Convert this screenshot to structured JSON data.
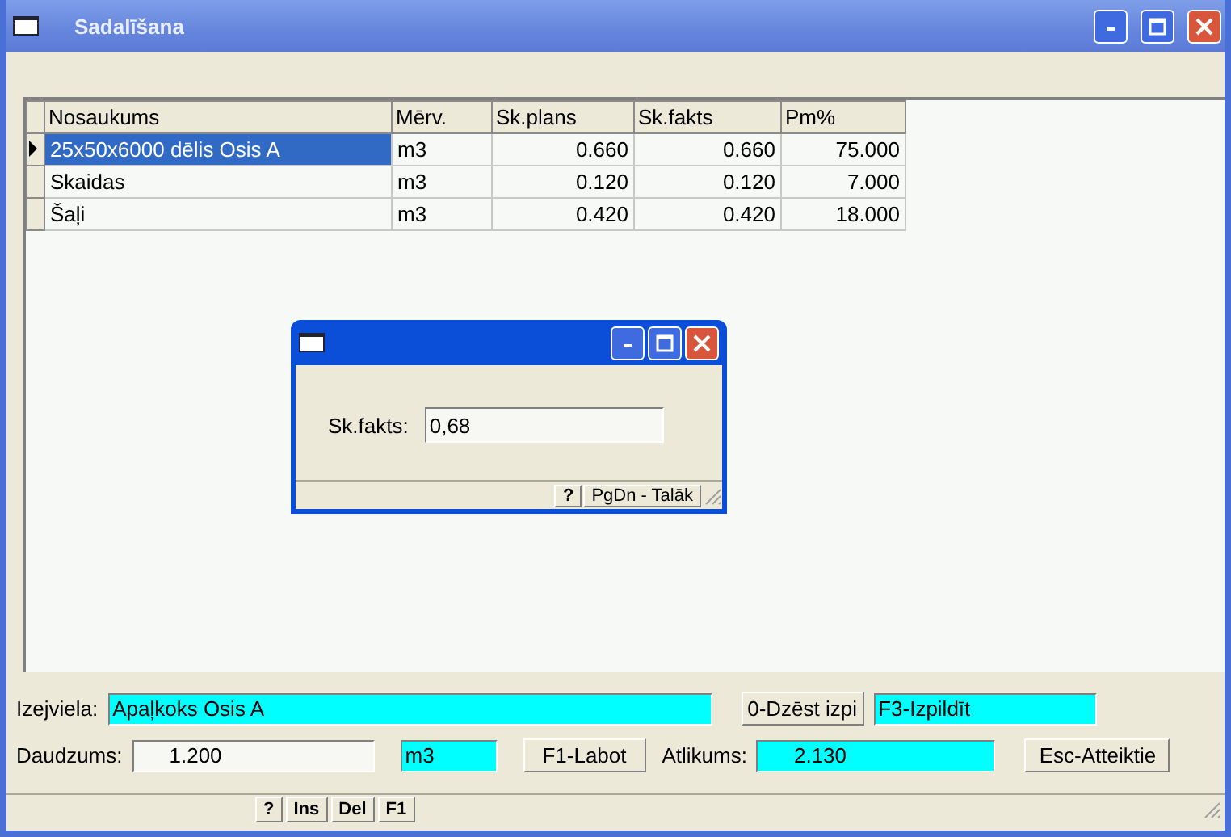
{
  "window": {
    "title": "Sadalīšana"
  },
  "table": {
    "columns": [
      "Nosaukums",
      "Mērv.",
      "Sk.plans",
      "Sk.fakts",
      "Pm%"
    ],
    "rows": [
      {
        "selected": true,
        "cells": [
          "25x50x6000 dēlis Osis A",
          "m3",
          "0.660",
          "0.660",
          "75.000"
        ]
      },
      {
        "selected": false,
        "cells": [
          "Skaidas",
          "m3",
          "0.120",
          "0.120",
          "7.000"
        ]
      },
      {
        "selected": false,
        "cells": [
          "Šaļi",
          "m3",
          "0.420",
          "0.420",
          "18.000"
        ]
      }
    ]
  },
  "dialog": {
    "label": "Sk.fakts:",
    "value": "0,68",
    "status_keys": [
      "?",
      "PgDn - Talāk"
    ]
  },
  "form": {
    "izejviela_label": "Izejviela:",
    "izejviela_value": "Apaļkoks Osis A",
    "delete_button": "0-Dzēst izpi",
    "run_field": "F3-Izpildīt",
    "daudzums_label": "Daudzums:",
    "daudzums_value": "1.200",
    "unit": "m3",
    "edit_button": "F1-Labot",
    "atlikums_label": "Atlikums:",
    "atlikums_value": "2.130",
    "cancel_button": "Esc-Atteiktie"
  },
  "status_bar": {
    "keys": [
      "?",
      "Ins",
      "Del",
      "F1"
    ]
  }
}
